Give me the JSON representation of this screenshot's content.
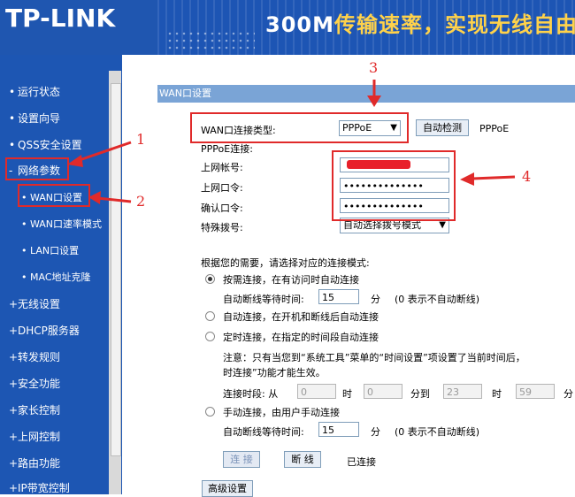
{
  "header": {
    "logo": "TP-LINK",
    "banner_text_a": "300M",
    "banner_text_b": "传输速率，实现无线自由"
  },
  "sidebar": {
    "items": [
      {
        "label": "运行状态"
      },
      {
        "label": "设置向导"
      },
      {
        "label": "QSS安全设置"
      },
      {
        "label": "网络参数"
      },
      {
        "label": "WAN口设置"
      },
      {
        "label": "WAN口速率模式"
      },
      {
        "label": "LAN口设置"
      },
      {
        "label": "MAC地址克隆"
      },
      {
        "label": "无线设置"
      },
      {
        "label": "DHCP服务器"
      },
      {
        "label": "转发规则"
      },
      {
        "label": "安全功能"
      },
      {
        "label": "家长控制"
      },
      {
        "label": "上网控制"
      },
      {
        "label": "路由功能"
      },
      {
        "label": "IP带宽控制"
      }
    ]
  },
  "main": {
    "title": "WAN口设置",
    "wan_type_label": "WAN口连接类型:",
    "wan_type_value": "PPPoE",
    "auto_detect": "自动检测",
    "wan_type_hint": "PPPoE",
    "pppoe_section": "PPPoE连接:",
    "username_label": "上网帐号:",
    "password_label": "上网口令:",
    "confirm_label": "确认口令:",
    "password_value": "••••••••••••••",
    "confirm_value": "••••••••••••••",
    "dial_label": "特殊拨号:",
    "dial_value": "自动选择拨号模式",
    "mode_prompt": "根据您的需要，请选择对应的连接模式:",
    "opt_demand": "按需连接，在有访问时自动连接",
    "idle_label": "自动断线等待时间:",
    "idle_value": "15",
    "idle_unit": "分",
    "idle_hint": "(0 表示不自动断线)",
    "opt_auto": "自动连接，在开机和断线后自动连接",
    "opt_timed": "定时连接，在指定的时间段自动连接",
    "note_line1": "注意：只有当您到“系统工具”菜单的“时间设置”项设置了当前时间后，",
    "note_line2": "时连接”功能才能生效。",
    "period_label": "连接时段: 从",
    "from_h": "0",
    "hour_unit": "时",
    "from_m": "0",
    "to_label": "分到",
    "to_h": "23",
    "to_m": "59",
    "min_unit": "分",
    "opt_manual": "手动连接，由用户手动连接",
    "idle_label2": "自动断线等待时间:",
    "idle_value2": "15",
    "idle_unit2": "分",
    "idle_hint2": "(0 表示不自动断线)",
    "connect_btn": "连 接",
    "disconnect_btn": "断 线",
    "status": "已连接",
    "advanced_btn": "高级设置"
  },
  "annotations": {
    "n1": "1",
    "n2": "2",
    "n3": "3",
    "n4": "4",
    "color": "#e02a2a"
  }
}
